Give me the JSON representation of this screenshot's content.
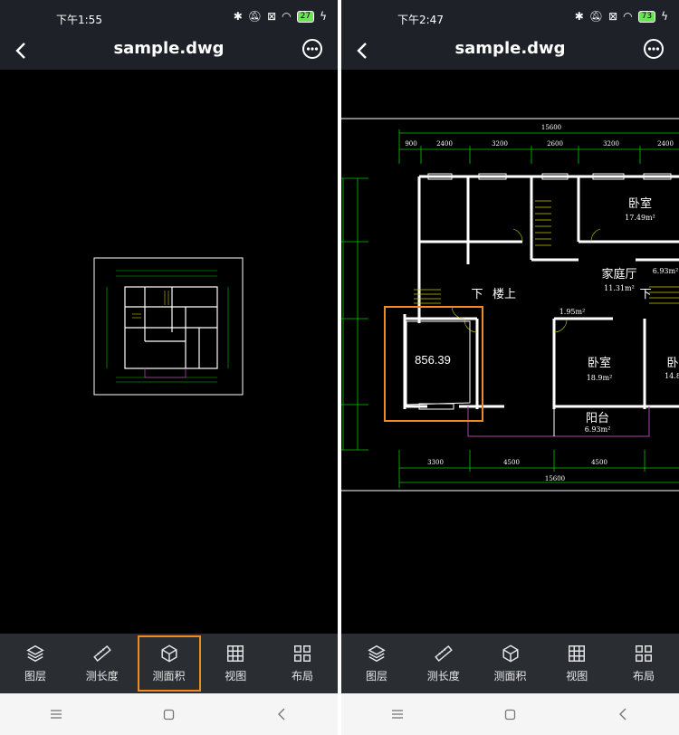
{
  "left": {
    "status": {
      "time": "下午1:55",
      "battery": "27"
    },
    "title": "sample.dwg"
  },
  "right": {
    "status": {
      "time": "下午2:47",
      "battery": "73"
    },
    "title": "sample.dwg",
    "measurement": "856.39",
    "plan": {
      "dim_top_total": "15600",
      "dim_top": [
        "900",
        "2400",
        "3200",
        "2600",
        "3200",
        "2400"
      ],
      "dim_bottom": [
        "3300",
        "4500",
        "4500"
      ],
      "dim_bottom_total": "15600",
      "rooms": {
        "bedroom1": "卧室",
        "bedroom1_area": "17.49m²",
        "family_hall": "家庭厅",
        "family_hall_area": "11.31m²",
        "small_area": "6.93m²",
        "stair_down1": "下",
        "stair_up": "楼上",
        "stair_down2": "下",
        "hall_area": "1.95m²",
        "bedroom2": "卧室",
        "bedroom2_area": "18.9m²",
        "bedroom3": "卧",
        "bedroom3_area": "14.8",
        "balcony": "阳台",
        "balcony_area": "6.93m²"
      }
    }
  },
  "toolbar": {
    "layers": "图层",
    "measure_length": "测长度",
    "measure_area": "测面积",
    "view": "视图",
    "layout": "布局"
  },
  "icons": {
    "back": "chevron-left-icon",
    "more": "more-circle-icon",
    "layers": "layers-icon",
    "ruler": "ruler-icon",
    "area": "cube-icon",
    "view": "grid-icon",
    "layout": "layout-icon",
    "nav_menu": "menu-icon",
    "nav_home": "square-icon",
    "nav_back": "triangle-back-icon"
  },
  "colors": {
    "highlight": "#f08a24",
    "cad_dim": "#00c800",
    "cad_purple": "#b040b0"
  }
}
